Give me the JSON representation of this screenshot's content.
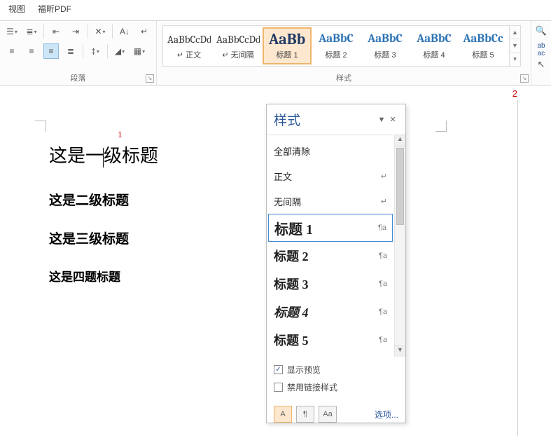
{
  "tabs": {
    "view": "视图",
    "foxit": "福昕PDF"
  },
  "ribbon": {
    "paragraph_label": "段落",
    "styles_label": "样式"
  },
  "gallery": [
    {
      "preview": "AaBbCcDd",
      "name": "正文",
      "cls": ""
    },
    {
      "preview": "AaBbCcDd",
      "name": "无间隔",
      "cls": ""
    },
    {
      "preview": "AaBb",
      "name": "标题 1",
      "cls": "h1",
      "selected": true
    },
    {
      "preview": "AaBbC",
      "name": "标题 2",
      "cls": "hn"
    },
    {
      "preview": "AaBbC",
      "name": "标题 3",
      "cls": "hn"
    },
    {
      "preview": "AaBbC",
      "name": "标题 4",
      "cls": "hn"
    },
    {
      "preview": "AaBbCc",
      "name": "标题 5",
      "cls": "hn5"
    }
  ],
  "page_number": "2",
  "doc": {
    "cursor_label": "1",
    "h1a": "这是一",
    "h1b": "级标题",
    "h2": "这是二级标题",
    "h3": "这是三级标题",
    "h4": "这是四题标题"
  },
  "pane": {
    "title": "样式",
    "items": [
      {
        "label": "全部清除",
        "cls": "small",
        "mark": ""
      },
      {
        "label": "正文",
        "cls": "small",
        "mark": "↵"
      },
      {
        "label": "无间隔",
        "cls": "small",
        "mark": "↵"
      },
      {
        "label": "标题 1",
        "cls": "h1",
        "mark": "¶a",
        "selected": true
      },
      {
        "label": "标题 2",
        "cls": "h2",
        "mark": "¶a"
      },
      {
        "label": "标题 3",
        "cls": "h3",
        "mark": "¶a"
      },
      {
        "label": "标题 4",
        "cls": "h4",
        "mark": "¶a"
      },
      {
        "label": "标题 5",
        "cls": "h5",
        "mark": "¶a"
      }
    ],
    "show_preview": "显示预览",
    "disable_linked": "禁用链接样式",
    "options": "选项..."
  }
}
